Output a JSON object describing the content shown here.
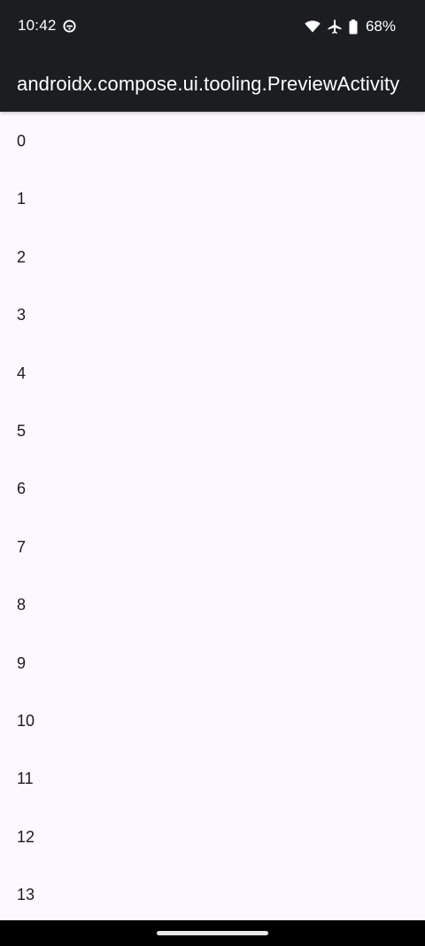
{
  "status_bar": {
    "time": "10:42",
    "battery": "68%",
    "icons": [
      "app-notification-icon",
      "wifi-icon",
      "airplane-icon",
      "battery-icon"
    ]
  },
  "app_bar": {
    "title": "androidx.compose.ui.tooling.PreviewActivity"
  },
  "list": {
    "items": [
      "0",
      "1",
      "2",
      "3",
      "4",
      "5",
      "6",
      "7",
      "8",
      "9",
      "10",
      "11",
      "12",
      "13"
    ]
  },
  "colors": {
    "bar_background": "#1b1d21",
    "content_background": "#fbf8ff",
    "text": "#1c1b1f"
  }
}
